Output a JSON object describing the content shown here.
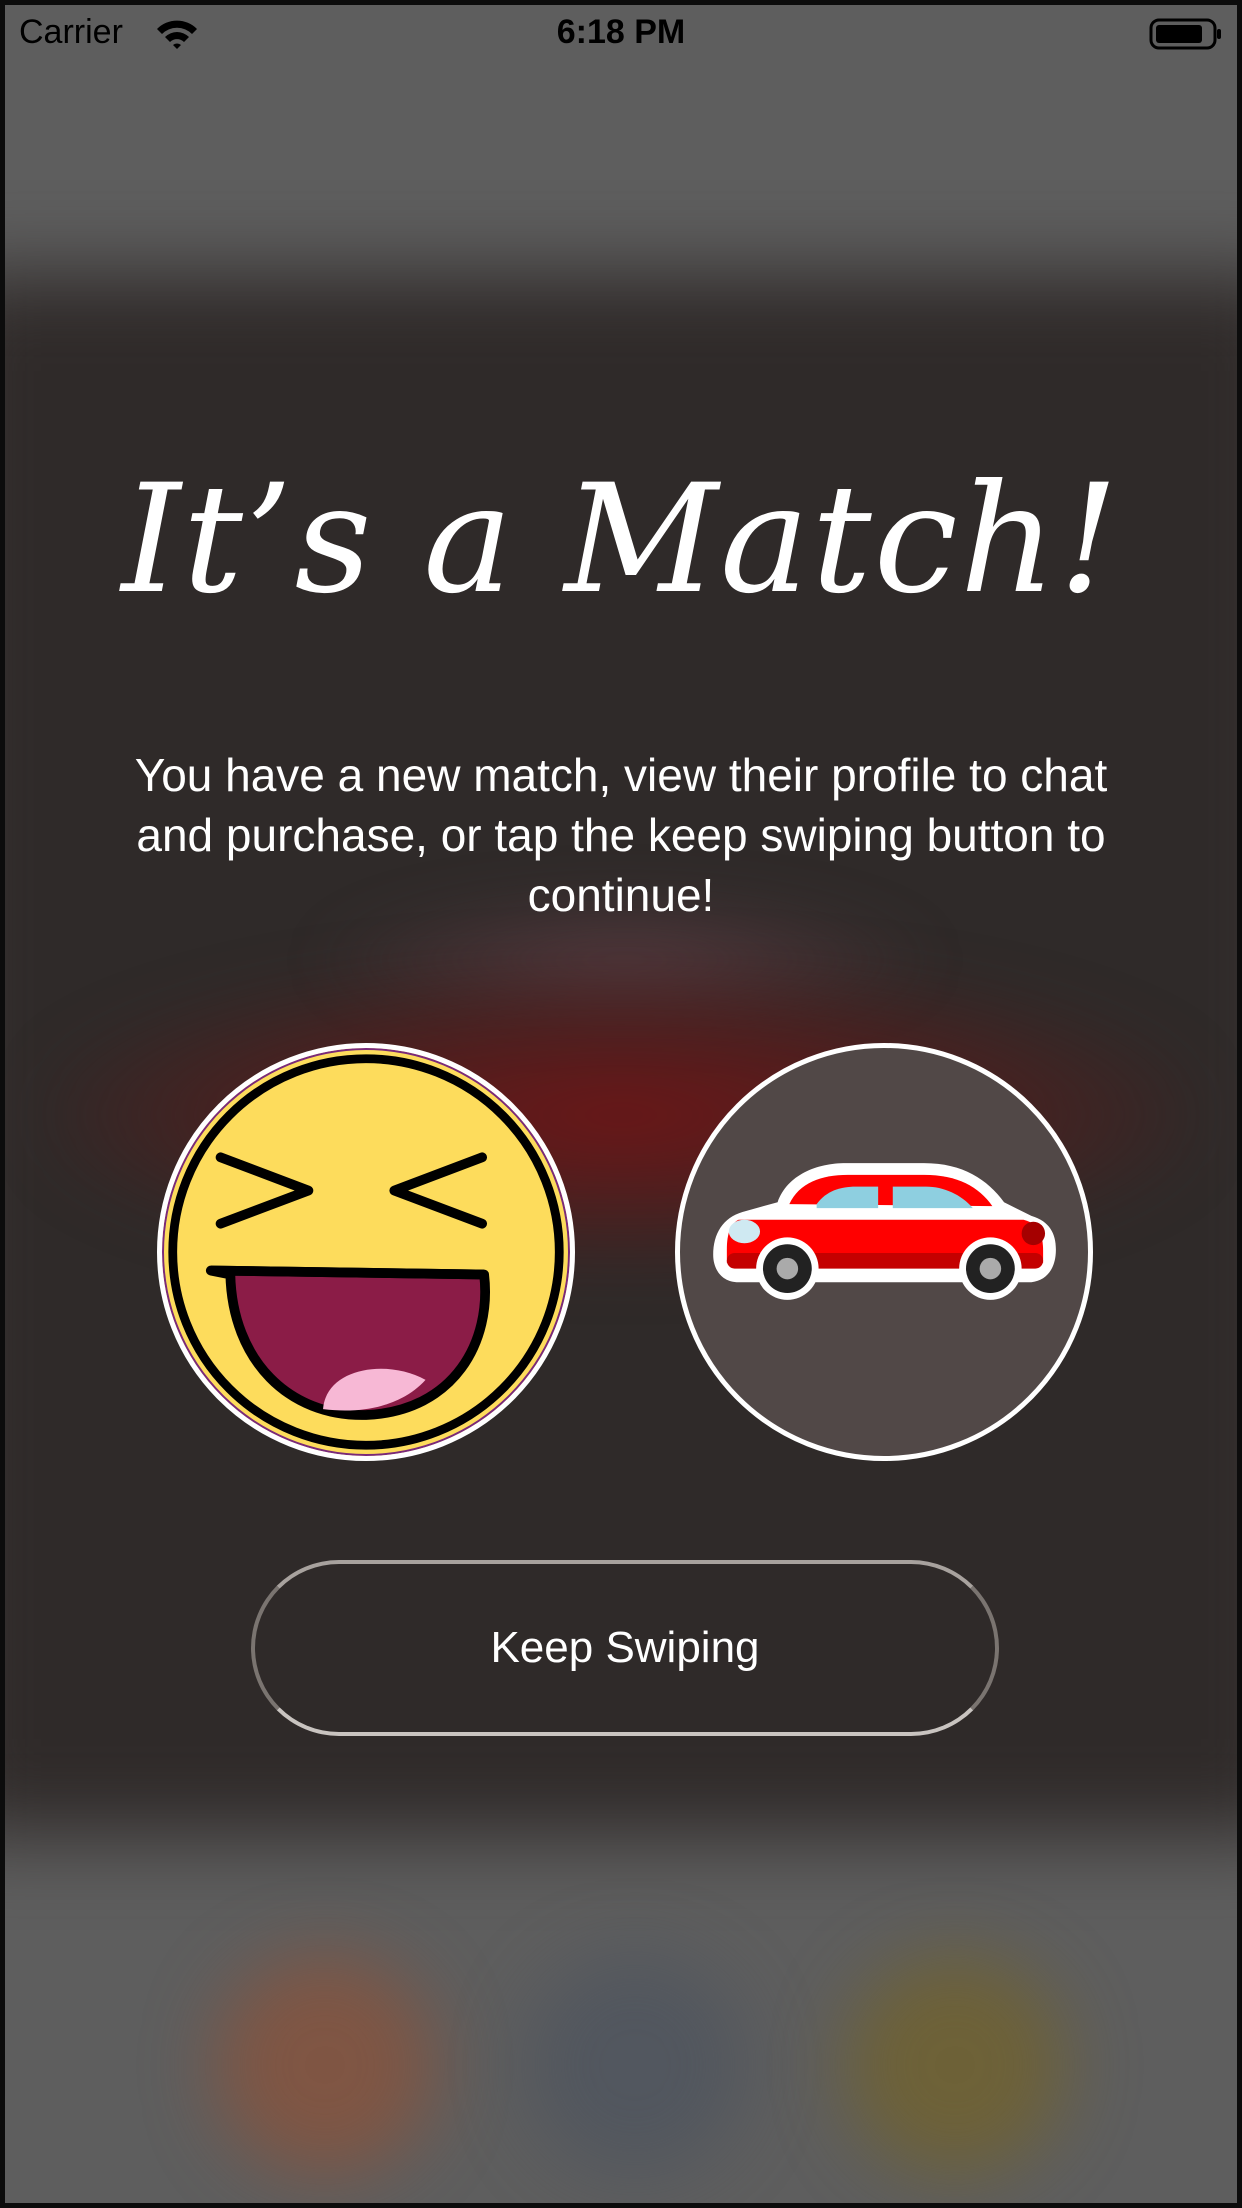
{
  "status_bar": {
    "carrier": "Carrier",
    "time": "6:18 PM",
    "icons": [
      "wifi-icon",
      "battery-icon"
    ]
  },
  "match": {
    "title": "It’s a Match!",
    "message": "You have a new match, view their profile to chat and purchase, or tap the keep swiping button to continue!",
    "left_avatar": {
      "icon": "laughing-emoji-icon"
    },
    "right_avatar": {
      "icon": "red-car-icon"
    },
    "keep_swiping_label": "Keep Swiping"
  },
  "colors": {
    "background_dark": "#2f2a29",
    "text": "#ffffff",
    "emoji_yellow": "#fddc5c",
    "car_red": "#ff0000",
    "car_glass": "#8ecfe0",
    "right_avatar_bg": "#514847"
  }
}
